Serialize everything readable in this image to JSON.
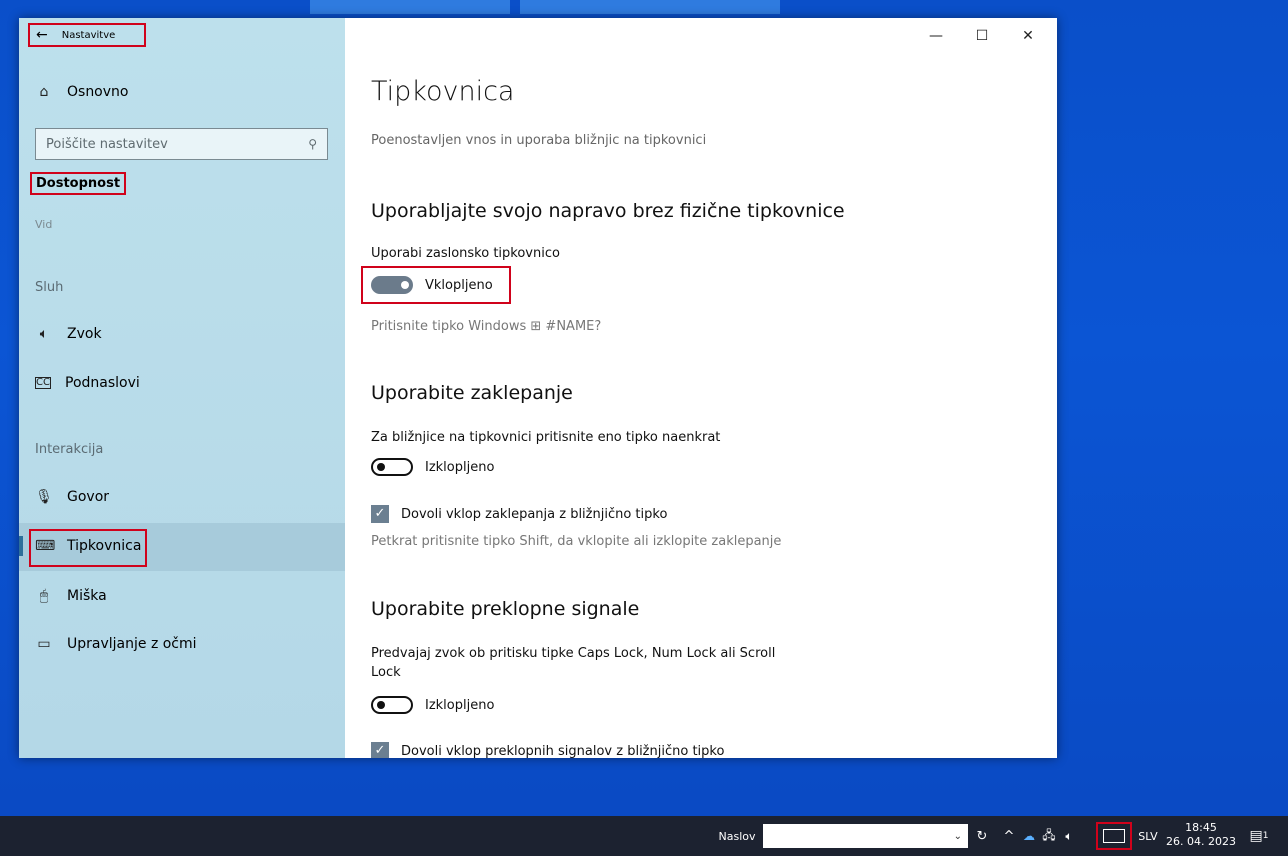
{
  "window": {
    "back_label": "Nastavitve",
    "controls": {
      "minimize": "—",
      "maximize": "☐",
      "close": "✕"
    }
  },
  "sidebar": {
    "home": "Osnovno",
    "search_placeholder": "Poiščite nastavitev",
    "category": "Dostopnost",
    "vid_partial": "Vid",
    "section_hearing": "Sluh",
    "item_sound": "Zvok",
    "item_captions": "Podnaslovi",
    "section_interaction": "Interakcija",
    "item_speech": "Govor",
    "item_keyboard": "Tipkovnica",
    "item_mouse": "Miška",
    "item_eye": "Upravljanje z očmi"
  },
  "main": {
    "title": "Tipkovnica",
    "subtitle": "Poenostavljen vnos in uporaba bližnjic na tipkovnici",
    "section1": {
      "heading": "Uporabljajte svojo napravo brez fizične tipkovnice",
      "label": "Uporabi zaslonsko tipkovnico",
      "state": "Vklopljeno",
      "is_on": true,
      "hint": "Pritisnite tipko Windows ⊞ #NAME?"
    },
    "section2": {
      "heading": "Uporabite zaklepanje",
      "label": "Za bližnjice na tipkovnici pritisnite eno tipko naenkrat",
      "state": "Izklopljeno",
      "is_on": false,
      "checkbox": "Dovoli vklop zaklepanja z bližnjično tipko",
      "checkbox_checked": true,
      "hint": "Petkrat pritisnite tipko Shift, da vklopite ali izklopite zaklepanje"
    },
    "section3": {
      "heading": "Uporabite preklopne signale",
      "label_line1": "Predvajaj zvok ob pritisku tipke Caps Lock, Num Lock ali Scroll",
      "label_line2": "Lock",
      "state": "Izklopljeno",
      "is_on": false,
      "checkbox": "Dovoli vklop preklopnih signalov z bližnjično tipko",
      "checkbox_checked": true
    }
  },
  "taskbar": {
    "search_label": "Naslov",
    "language": "SLV",
    "time": "18:45",
    "date": "26. 04. 2023",
    "notification_count": "1"
  },
  "colors": {
    "desktop": "#0b55d4",
    "sidebar": "#b9dbe8",
    "highlight": "#d0021b",
    "taskbar": "#1c2230"
  }
}
